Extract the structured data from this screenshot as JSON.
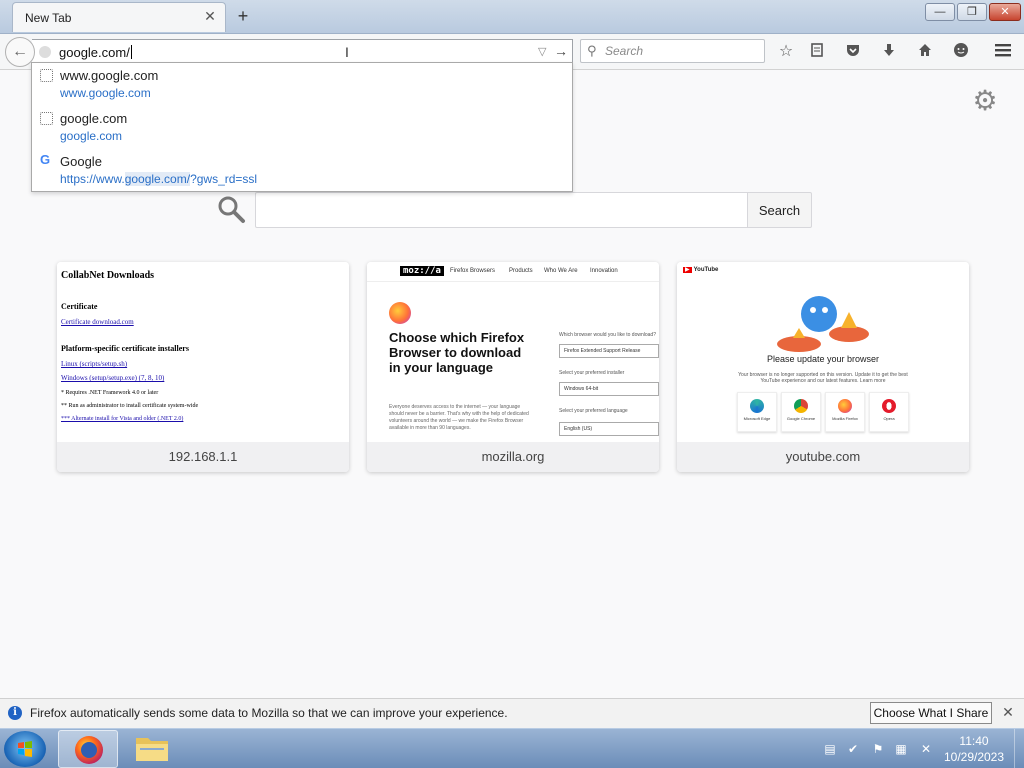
{
  "tab": {
    "title": "New Tab",
    "close": "✕",
    "new_tab": "+"
  },
  "window": {
    "minimize": "—",
    "maximize": "❐",
    "close": "✕"
  },
  "navbar": {
    "url_value": "google.com/",
    "search_placeholder": "Search"
  },
  "suggestions": [
    {
      "title": "www.google.com",
      "url": "www.google.com",
      "icon": "page-icon"
    },
    {
      "title": "google.com",
      "url": "google.com",
      "icon": "page-icon"
    },
    {
      "title": "Google",
      "url_pre": "https://www.",
      "url_hl": "google.com/",
      "url_post": "?gws_rd=ssl",
      "icon": "google-g-icon"
    }
  ],
  "search": {
    "button_label": "Search"
  },
  "tiles": [
    {
      "label": "192.168.1.1",
      "page": {
        "title": "CollabNet Downloads",
        "cert_heading": "Certificate",
        "cert_link": "Certificate download.com",
        "platform_heading": "Platform-specific certificate installers",
        "link1": "Linux (scripts/setup.sh)",
        "link2": "Windows (setup/setup.exe) (7, 8, 10)",
        "note1": "* Requires .NET Framework 4.0 or later",
        "note2": "** Run as administrator to install certificate system-wide",
        "note3": "*** Alternate install for Vista and older (.NET 2.0)"
      }
    },
    {
      "label": "mozilla.org",
      "page": {
        "logo": "moz://a",
        "nav": [
          "Firefox Browsers",
          "Products",
          "Who We Are",
          "Innovation"
        ],
        "heading": "Choose which Firefox Browser to download in your language",
        "body": "Everyone deserves access to the internet — your language should never be a barrier. That's why with the help of dedicated volunteers around the world — we make the Firefox Browser available in more than 90 languages.",
        "q1": "Which browser would you like to download?",
        "sel1": "Firefox Extended Support Release",
        "q2": "Select your preferred installer",
        "sel2": "Windows 64-bit",
        "q3": "Select your preferred language",
        "sel3": "English (US)"
      }
    },
    {
      "label": "youtube.com",
      "page": {
        "logo": "YouTube",
        "title": "Please update your browser",
        "subtitle": "Your browser is no longer supported on this version. Update it to get the best YouTube experience and our latest features. Learn more",
        "browsers": [
          "Microsoft Edge",
          "Google Chrome",
          "Mozilla Firefox",
          "Opera"
        ]
      }
    }
  ],
  "notification": {
    "text": "Firefox automatically sends some data to Mozilla so that we can improve your experience.",
    "button": "Choose What I Share",
    "close": "✕"
  },
  "taskbar": {
    "time": "11:40",
    "date": "10/29/2023"
  }
}
